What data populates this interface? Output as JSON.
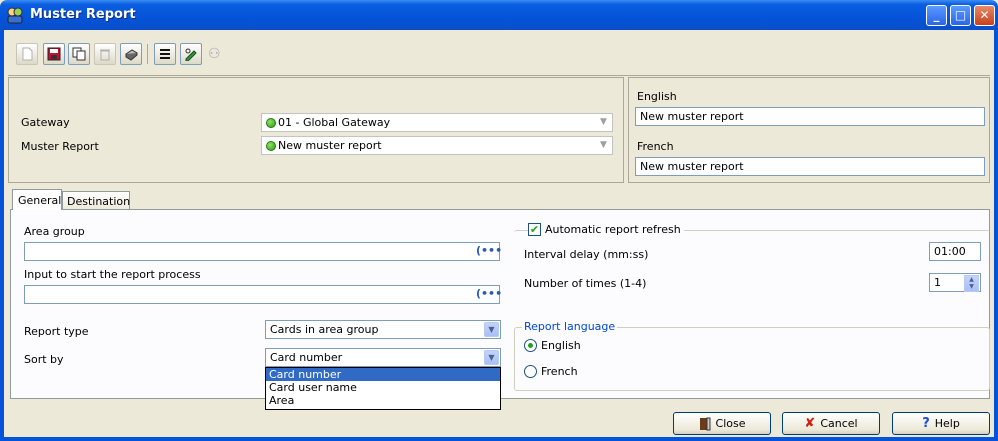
{
  "window": {
    "title": "Muster Report"
  },
  "header": {
    "gateway_label": "Gateway",
    "gateway_value": "01 - Global Gateway",
    "muster_label": "Muster Report",
    "muster_value": "New muster report",
    "english_label": "English",
    "english_value": "New muster report",
    "french_label": "French",
    "french_value": "New muster report"
  },
  "tabs": [
    {
      "label": "General",
      "active": true
    },
    {
      "label": "Destination",
      "active": false
    }
  ],
  "general": {
    "area_group_label": "Area group",
    "area_group_value": "",
    "input_label": "Input to start the report process",
    "input_value": "",
    "report_type_label": "Report type",
    "report_type_value": "Cards in area group",
    "sort_by_label": "Sort by",
    "sort_by_value": "Card number",
    "sort_options": [
      "Card number",
      "Card user name",
      "Area"
    ],
    "auto_refresh_label": "Automatic report refresh",
    "auto_refresh_checked": true,
    "interval_label": "Interval delay (mm:ss)",
    "interval_value": "01:00",
    "times_label": "Number of times (1-4)",
    "times_value": "1",
    "report_language_label": "Report language",
    "lang_english": "English",
    "lang_french": "French",
    "lang_selected": "English"
  },
  "footer": {
    "close_label": "Close",
    "cancel_label": "Cancel",
    "help_label": "Help"
  },
  "colors": {
    "titlebar": "#0553d9",
    "selection": "#316ac5",
    "group_title": "#0046d5",
    "face": "#ece9d8"
  }
}
